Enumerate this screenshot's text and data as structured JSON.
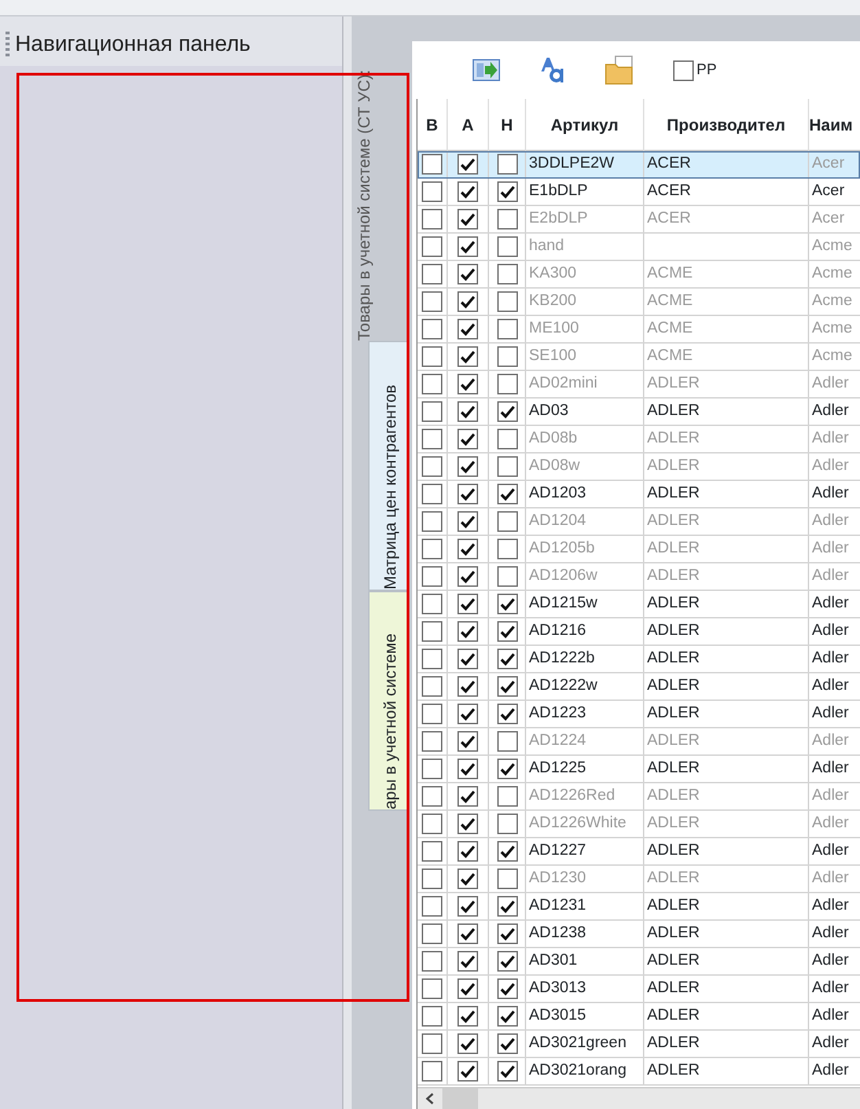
{
  "navigation_panel": {
    "title": "Навигационная панель"
  },
  "side_tabs": {
    "caption": "Товары в учетной системе (СТ УС):",
    "tabs": [
      {
        "label": "Матрица цен контрагентов",
        "selected": false
      },
      {
        "label": "ары в учетной системе",
        "selected": true
      }
    ]
  },
  "toolbar": {
    "pp_checkbox": {
      "label": "PP",
      "checked": false
    }
  },
  "table": {
    "columns": [
      "В",
      "А",
      "Н",
      "Артикул",
      "Производител",
      "Наим"
    ],
    "rows": [
      {
        "b": false,
        "a": true,
        "h": false,
        "article": "3DDLPE2W",
        "maker": "ACER",
        "name": "Acer",
        "selected": true
      },
      {
        "b": false,
        "a": true,
        "h": true,
        "article": "E1bDLP",
        "maker": "ACER",
        "name": "Acer",
        "selected": false
      },
      {
        "b": false,
        "a": true,
        "h": false,
        "article": "E2bDLP",
        "maker": "ACER",
        "name": "Acer",
        "selected": false
      },
      {
        "b": false,
        "a": true,
        "h": false,
        "article": "hand",
        "name": "Acme",
        "selected": false
      },
      {
        "b": false,
        "a": true,
        "h": false,
        "article": "KA300",
        "maker": "ACME",
        "name": "Acme",
        "selected": false
      },
      {
        "b": false,
        "a": true,
        "h": false,
        "article": "KB200",
        "maker": "ACME",
        "name": "Acme",
        "selected": false
      },
      {
        "b": false,
        "a": true,
        "h": false,
        "article": "ME100",
        "maker": "ACME",
        "name": "Acme",
        "selected": false
      },
      {
        "b": false,
        "a": true,
        "h": false,
        "article": "SE100",
        "maker": "ACME",
        "name": "Acme",
        "selected": false
      },
      {
        "b": false,
        "a": true,
        "h": false,
        "article": "AD02mini",
        "maker": "ADLER",
        "name": "Adler",
        "selected": false
      },
      {
        "b": false,
        "a": true,
        "h": true,
        "article": "AD03",
        "maker": "ADLER",
        "name": "Adler",
        "selected": false
      },
      {
        "b": false,
        "a": true,
        "h": false,
        "article": "AD08b",
        "maker": "ADLER",
        "name": "Adler",
        "selected": false
      },
      {
        "b": false,
        "a": true,
        "h": false,
        "article": "AD08w",
        "maker": "ADLER",
        "name": "Adler",
        "selected": false
      },
      {
        "b": false,
        "a": true,
        "h": true,
        "article": "AD1203",
        "maker": "ADLER",
        "name": "Adler",
        "selected": false
      },
      {
        "b": false,
        "a": true,
        "h": false,
        "article": "AD1204",
        "maker": "ADLER",
        "name": "Adler",
        "selected": false
      },
      {
        "b": false,
        "a": true,
        "h": false,
        "article": "AD1205b",
        "maker": "ADLER",
        "name": "Adler",
        "selected": false
      },
      {
        "b": false,
        "a": true,
        "h": false,
        "article": "AD1206w",
        "maker": "ADLER",
        "name": "Adler",
        "selected": false
      },
      {
        "b": false,
        "a": true,
        "h": true,
        "article": "AD1215w",
        "maker": "ADLER",
        "name": "Adler",
        "selected": false
      },
      {
        "b": false,
        "a": true,
        "h": true,
        "article": "AD1216",
        "maker": "ADLER",
        "name": "Adler",
        "selected": false
      },
      {
        "b": false,
        "a": true,
        "h": true,
        "article": "AD1222b",
        "maker": "ADLER",
        "name": "Adler",
        "selected": false
      },
      {
        "b": false,
        "a": true,
        "h": true,
        "article": "AD1222w",
        "maker": "ADLER",
        "name": "Adler",
        "selected": false
      },
      {
        "b": false,
        "a": true,
        "h": true,
        "article": "AD1223",
        "maker": "ADLER",
        "name": "Adler",
        "selected": false
      },
      {
        "b": false,
        "a": true,
        "h": false,
        "article": "AD1224",
        "maker": "ADLER",
        "name": "Adler",
        "selected": false
      },
      {
        "b": false,
        "a": true,
        "h": true,
        "article": "AD1225",
        "maker": "ADLER",
        "name": "Adler",
        "selected": false
      },
      {
        "b": false,
        "a": true,
        "h": false,
        "article": "AD1226Red",
        "maker": "ADLER",
        "name": "Adler",
        "selected": false
      },
      {
        "b": false,
        "a": true,
        "h": false,
        "article": "AD1226White",
        "maker": "ADLER",
        "name": "Adler",
        "selected": false
      },
      {
        "b": false,
        "a": true,
        "h": true,
        "article": "AD1227",
        "maker": "ADLER",
        "name": "Adler",
        "selected": false
      },
      {
        "b": false,
        "a": true,
        "h": false,
        "article": "AD1230",
        "maker": "ADLER",
        "name": "Adler",
        "selected": false
      },
      {
        "b": false,
        "a": true,
        "h": true,
        "article": "AD1231",
        "maker": "ADLER",
        "name": "Adler",
        "selected": false
      },
      {
        "b": false,
        "a": true,
        "h": true,
        "article": "AD1238",
        "maker": "ADLER",
        "name": "Adler",
        "selected": false
      },
      {
        "b": false,
        "a": true,
        "h": true,
        "article": "AD301",
        "maker": "ADLER",
        "name": "Adler",
        "selected": false
      },
      {
        "b": false,
        "a": true,
        "h": true,
        "article": "AD3013",
        "maker": "ADLER",
        "name": "Adler",
        "selected": false
      },
      {
        "b": false,
        "a": true,
        "h": true,
        "article": "AD3015",
        "maker": "ADLER",
        "name": "Adler",
        "selected": false
      },
      {
        "b": false,
        "a": true,
        "h": true,
        "article": "AD3021green",
        "maker": "ADLER",
        "name": "Adler",
        "selected": false
      },
      {
        "b": false,
        "a": true,
        "h": true,
        "article": "AD3021orang",
        "maker": "ADLER",
        "name": "Adler",
        "selected": false
      }
    ]
  }
}
